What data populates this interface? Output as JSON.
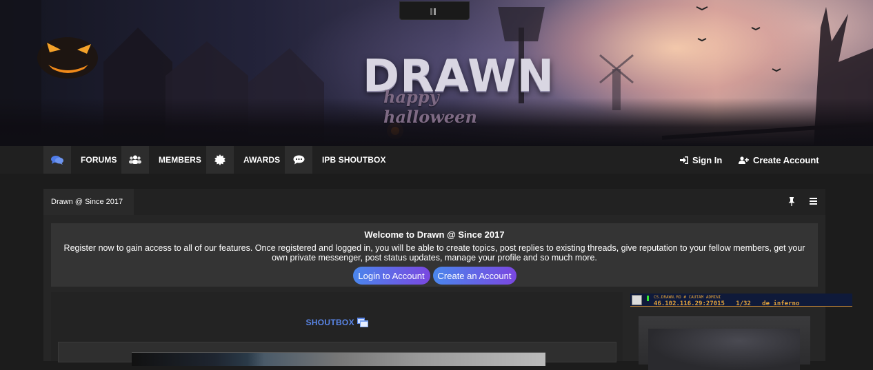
{
  "banner": {
    "brand": "DRAWN",
    "tagline": "happy halloween"
  },
  "nav": {
    "items": [
      {
        "label": "FORUMS",
        "icon": "comments-icon"
      },
      {
        "label": "MEMBERS",
        "icon": "users-icon"
      },
      {
        "label": "AWARDS",
        "icon": "award-badge-icon"
      },
      {
        "label": "IPB SHOUTBOX",
        "icon": "speech-bubble-icon"
      }
    ],
    "sign_in": "Sign In",
    "create_account": "Create Account"
  },
  "panel": {
    "tab_title": "Drawn @ Since 2017"
  },
  "welcome": {
    "title": "Welcome to Drawn @ Since 2017",
    "text": "Register now to gain access to all of our features. Once registered and logged in, you will be able to create topics, post replies to existing threads, give reputation to your fellow members, get your own private messenger, post status updates, manage your profile and so much more.",
    "login_button": "Login to Account",
    "create_button": "Create an Account"
  },
  "shoutbox": {
    "title": "SHOUTBOX"
  },
  "server": {
    "name": "CS.DRAWN.RO # CAUTAM ADMINI",
    "address": "46.102.116.29:27015",
    "players": "1/32",
    "map": "de_inferno"
  },
  "colors": {
    "accent": "#4a86ec",
    "accent_end": "#7a47e0",
    "shoutbox_title": "#5a86e8",
    "server_text": "#e2a23a"
  }
}
